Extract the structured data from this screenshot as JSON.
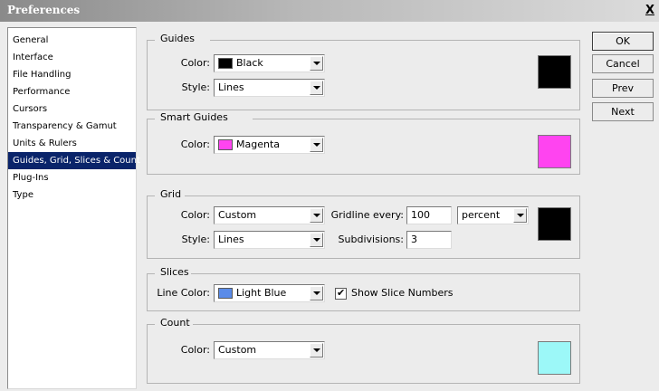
{
  "window": {
    "title": "Preferences",
    "close_label": "X"
  },
  "sidebar": {
    "items": [
      {
        "label": "General"
      },
      {
        "label": "Interface"
      },
      {
        "label": "File Handling"
      },
      {
        "label": "Performance"
      },
      {
        "label": "Cursors"
      },
      {
        "label": "Transparency & Gamut"
      },
      {
        "label": "Units & Rulers"
      },
      {
        "label": "Guides, Grid, Slices & Count",
        "selected": true
      },
      {
        "label": "Plug-Ins"
      },
      {
        "label": "Type"
      }
    ]
  },
  "guides": {
    "title": "Guides",
    "color_label": "Color:",
    "color_value": "Black",
    "color_hex": "#000000",
    "style_label": "Style:",
    "style_value": "Lines"
  },
  "smart_guides": {
    "title": "Smart Guides",
    "color_label": "Color:",
    "color_value": "Magenta",
    "color_hex": "#ff44f0"
  },
  "grid": {
    "title": "Grid",
    "color_label": "Color:",
    "color_value": "Custom",
    "color_hex": "#000000",
    "style_label": "Style:",
    "style_value": "Lines",
    "gridline_label": "Gridline every:",
    "gridline_value": "100",
    "unit_value": "percent",
    "subdivisions_label": "Subdivisions:",
    "subdivisions_value": "3"
  },
  "slices": {
    "title": "Slices",
    "line_color_label": "Line Color:",
    "line_color_value": "Light Blue",
    "line_color_hex": "#5a8be8",
    "show_numbers_label": "Show Slice Numbers",
    "show_numbers_checked": true
  },
  "count": {
    "title": "Count",
    "color_label": "Color:",
    "color_value": "Custom",
    "color_hex": "#9cf8f8"
  },
  "buttons": {
    "ok": "OK",
    "cancel": "Cancel",
    "prev": "Prev",
    "next": "Next"
  }
}
